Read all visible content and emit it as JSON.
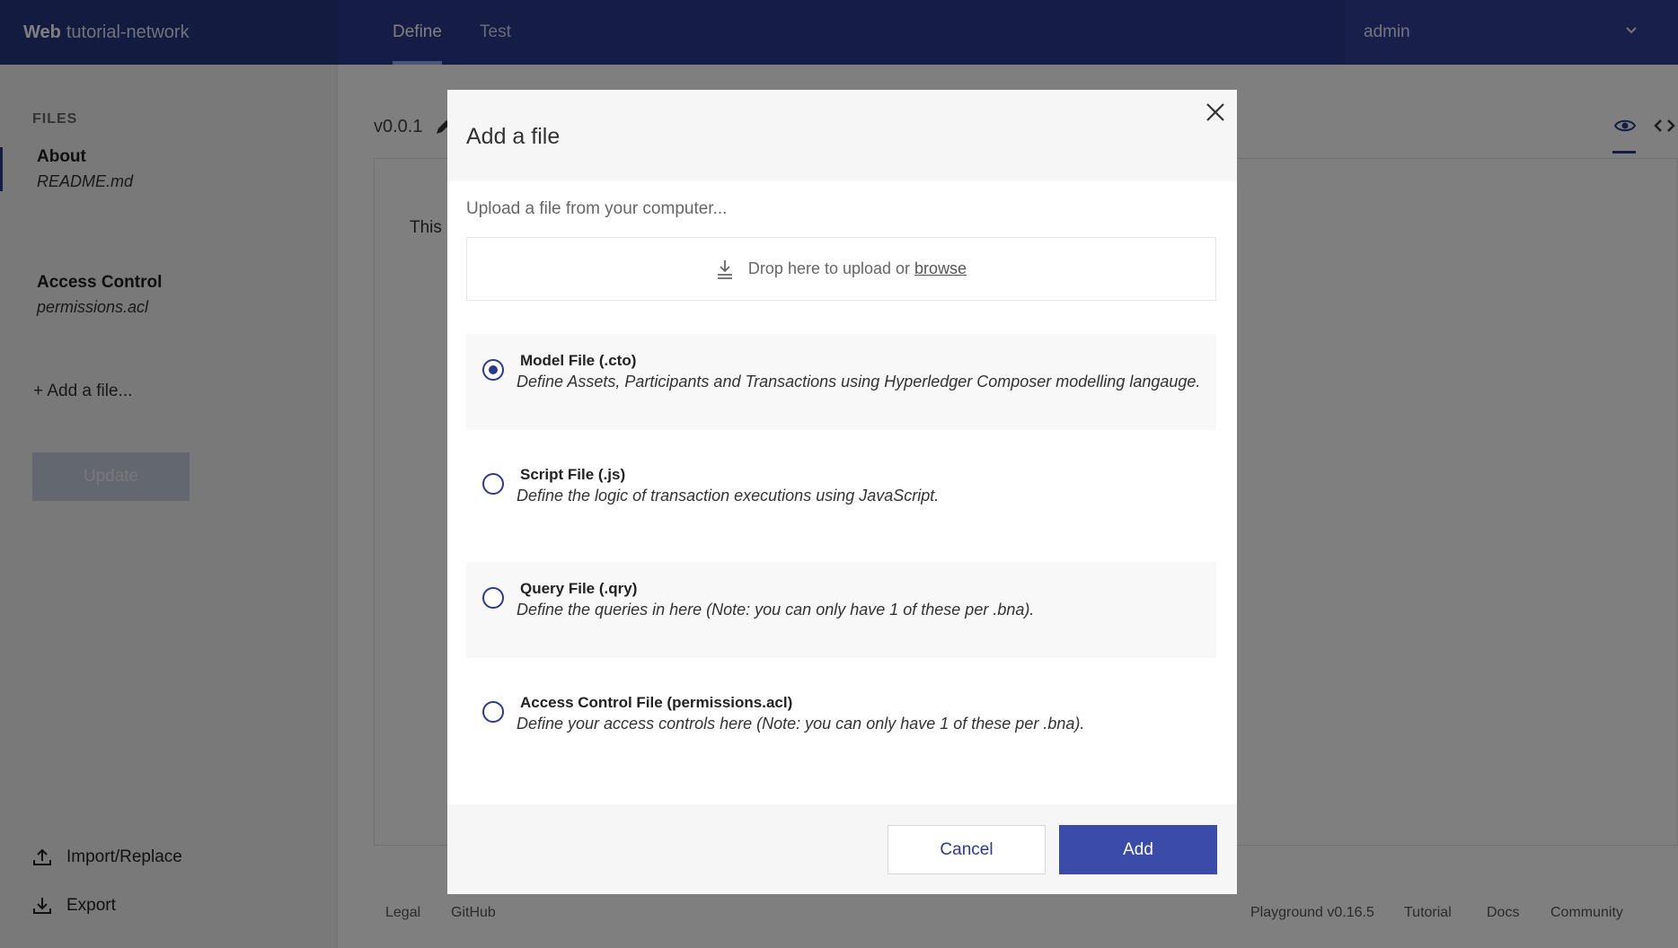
{
  "topbar": {
    "brand_bold": "Web",
    "brand_name": "tutorial-network",
    "tabs": [
      {
        "label": "Define",
        "active": true
      },
      {
        "label": "Test",
        "active": false
      }
    ],
    "user": "admin"
  },
  "sidebar": {
    "title": "FILES",
    "files": [
      {
        "name": "About",
        "file": "README.md",
        "selected": true
      },
      {
        "name": "Access Control",
        "file": "permissions.acl",
        "selected": false
      }
    ],
    "add_file": "+ Add a file...",
    "update_label": "Update",
    "import_label": "Import/Replace",
    "export_label": "Export"
  },
  "main": {
    "version": "v0.0.1",
    "editor_text": "This i"
  },
  "footer": {
    "legal": "Legal",
    "github": "GitHub",
    "playground_version": "Playground v0.16.5",
    "tutorial": "Tutorial",
    "docs": "Docs",
    "community": "Community"
  },
  "modal": {
    "title": "Add a file",
    "upload_hint": "Upload a file from your computer...",
    "drop_text": "Drop here to upload or",
    "browse_label": "browse",
    "options": [
      {
        "title": "Model File (.cto)",
        "desc": "Define Assets, Participants and Transactions using Hyperledger Composer modelling langauge.",
        "checked": true
      },
      {
        "title": "Script File (.js)",
        "desc": "Define the logic of transaction executions using JavaScript.",
        "checked": false
      },
      {
        "title": "Query File (.qry)",
        "desc": "Define the queries in here (Note: you can only have 1 of these per .bna).",
        "checked": false
      },
      {
        "title": "Access Control File (permissions.acl)",
        "desc": "Define your access controls here (Note: you can only have 1 of these per .bna).",
        "checked": false
      }
    ],
    "cancel_label": "Cancel",
    "add_label": "Add"
  },
  "colors": {
    "primary": "#2b3a8c",
    "add_button": "#3a4ba8",
    "overlay": "rgba(0,0,0,0.5)"
  }
}
